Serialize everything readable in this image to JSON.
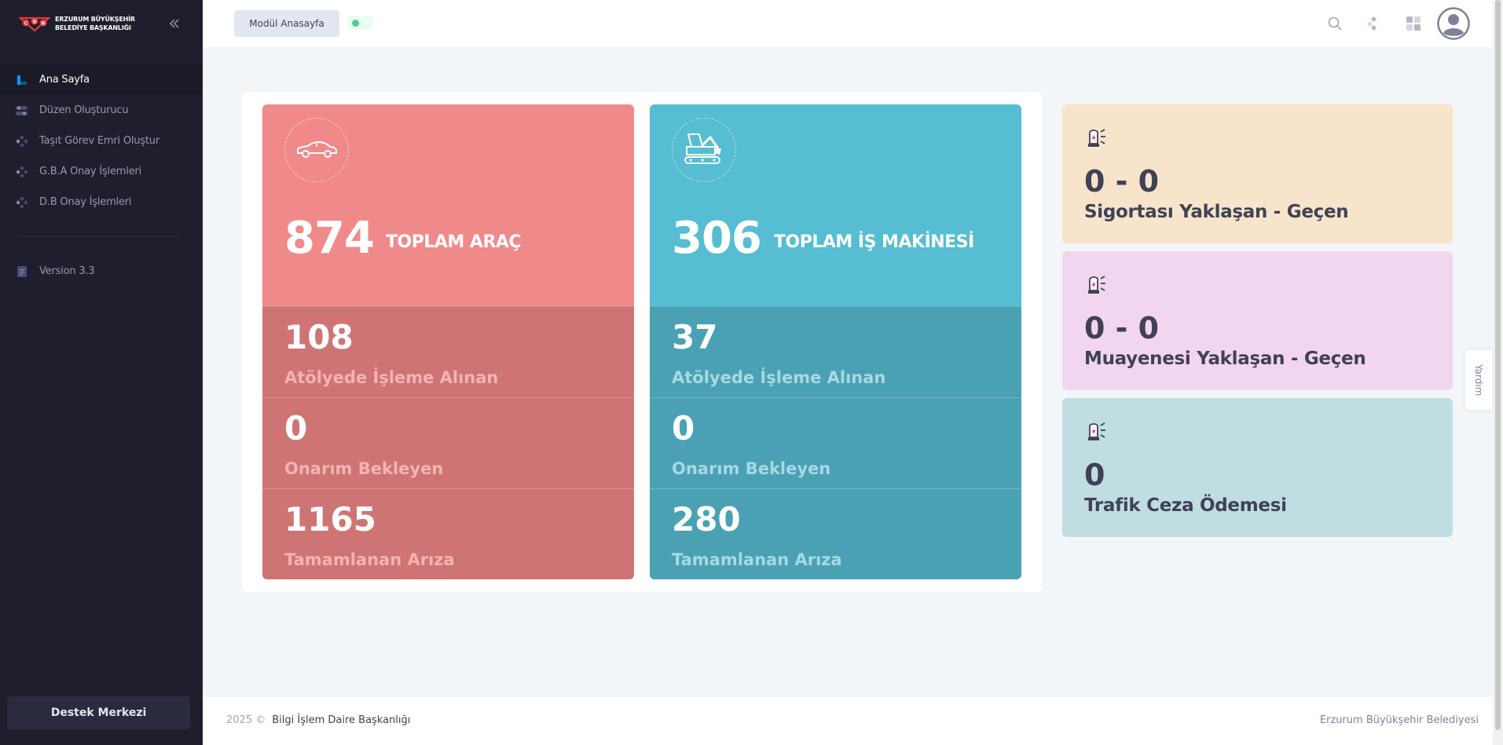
{
  "sidebar": {
    "brand_line1": "ERZURUM BÜYÜKŞEHİR",
    "brand_line2": "BELEDİYE BAŞKANLIĞI",
    "items": [
      {
        "label": "Ana Sayfa",
        "icon": "dashboard-icon",
        "active": true
      },
      {
        "label": "Düzen Oluşturucu",
        "icon": "toggle-icon"
      },
      {
        "label": "Taşıt Görev Emri Oluştur",
        "icon": "diamond-icon"
      },
      {
        "label": "G.B.A Onay İşlemleri",
        "icon": "diamond-icon"
      },
      {
        "label": "D.B Onay İşlemleri",
        "icon": "diamond-icon"
      }
    ],
    "version": "Version 3.3",
    "support_label": "Destek Merkezi"
  },
  "header": {
    "module_button": "Modül Anasayfa",
    "icons": [
      "search-icon",
      "sparkle-icon",
      "apps-grid-icon",
      "user-avatar-icon"
    ]
  },
  "cards": {
    "vehicles": {
      "total": "874",
      "total_label": "TOPLAM ARAÇ",
      "stats": [
        {
          "value": "108",
          "label": "Atölyede İşleme Alınan"
        },
        {
          "value": "0",
          "label": "Onarım Bekleyen"
        },
        {
          "value": "1165",
          "label": "Tamamlanan Arıza"
        }
      ],
      "color_top": "#f08a8a",
      "color_stat": "#cf7474"
    },
    "machines": {
      "total": "306",
      "total_label": "TOPLAM İŞ MAKİNESİ",
      "stats": [
        {
          "value": "37",
          "label": "Atölyede İşleme Alınan"
        },
        {
          "value": "0",
          "label": "Onarım Bekleyen"
        },
        {
          "value": "280",
          "label": "Tamamlanan Arıza"
        }
      ],
      "color_top": "#56bdd3",
      "color_stat": "#4aa1b4"
    }
  },
  "side_cards": [
    {
      "value": "0 - 0",
      "label": "Sigortası Yaklaşan - Geçen",
      "color": "#f7e4cb"
    },
    {
      "value": "0 - 0",
      "label": "Muayenesi Yaklaşan - Geçen",
      "color": "#f2d6ef"
    },
    {
      "value": "0",
      "label": "Trafik Ceza Ödemesi",
      "color": "#c0dde2"
    }
  ],
  "help_label": "Yardım",
  "footer": {
    "year": "2025 ©",
    "org": "Bilgi İşlem Daire Başkanlığı",
    "right": "Erzurum Büyükşehir Belediyesi"
  }
}
